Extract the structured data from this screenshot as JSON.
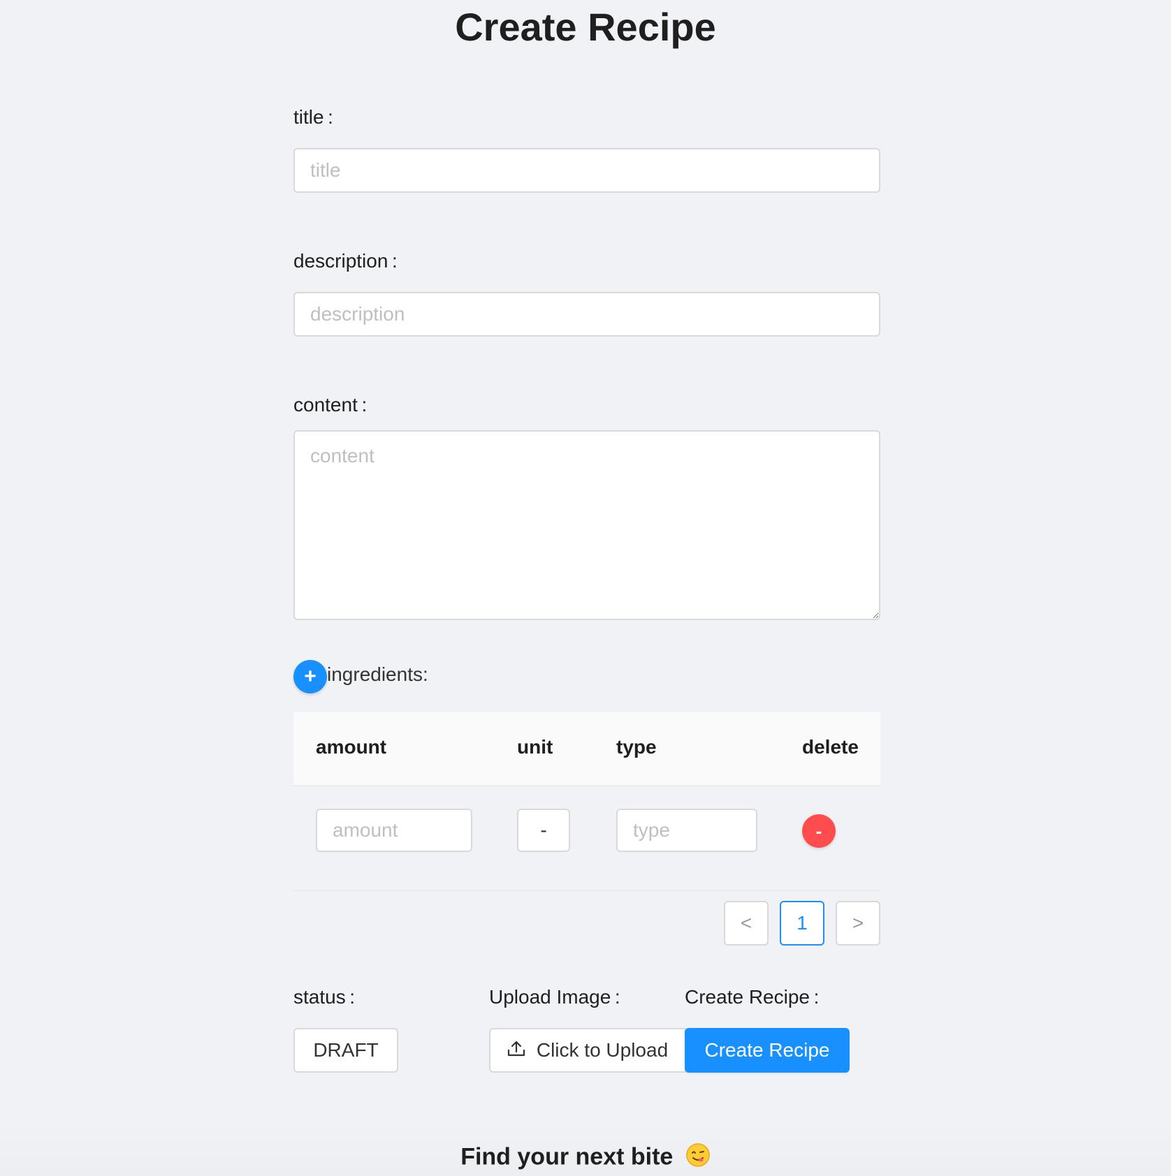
{
  "page_title": "Create Recipe",
  "fields": {
    "title": {
      "label": "title :",
      "placeholder": "title",
      "value": ""
    },
    "description": {
      "label": "description :",
      "placeholder": "description",
      "value": ""
    },
    "content": {
      "label": "content :",
      "placeholder": "content",
      "value": ""
    }
  },
  "ingredients": {
    "add_label": "+",
    "label": "ingredients:",
    "columns": [
      "amount",
      "unit",
      "type",
      "delete"
    ],
    "rows": [
      {
        "amount_placeholder": "amount",
        "unit": "-",
        "type_placeholder": "type",
        "delete_label": "-"
      }
    ]
  },
  "pagination": {
    "prev": "<",
    "current": "1",
    "next": ">"
  },
  "status": {
    "label": "status :",
    "value": "DRAFT"
  },
  "upload": {
    "label": "Upload Image :",
    "button": "Click to Upload",
    "icon": "upload-icon"
  },
  "create": {
    "label": "Create Recipe :",
    "button": "Create Recipe"
  },
  "footer": {
    "text": "Find your next bite"
  },
  "colors": {
    "primary": "#1890ff",
    "danger": "#ff4d4f",
    "background": "#f0f2f5"
  }
}
